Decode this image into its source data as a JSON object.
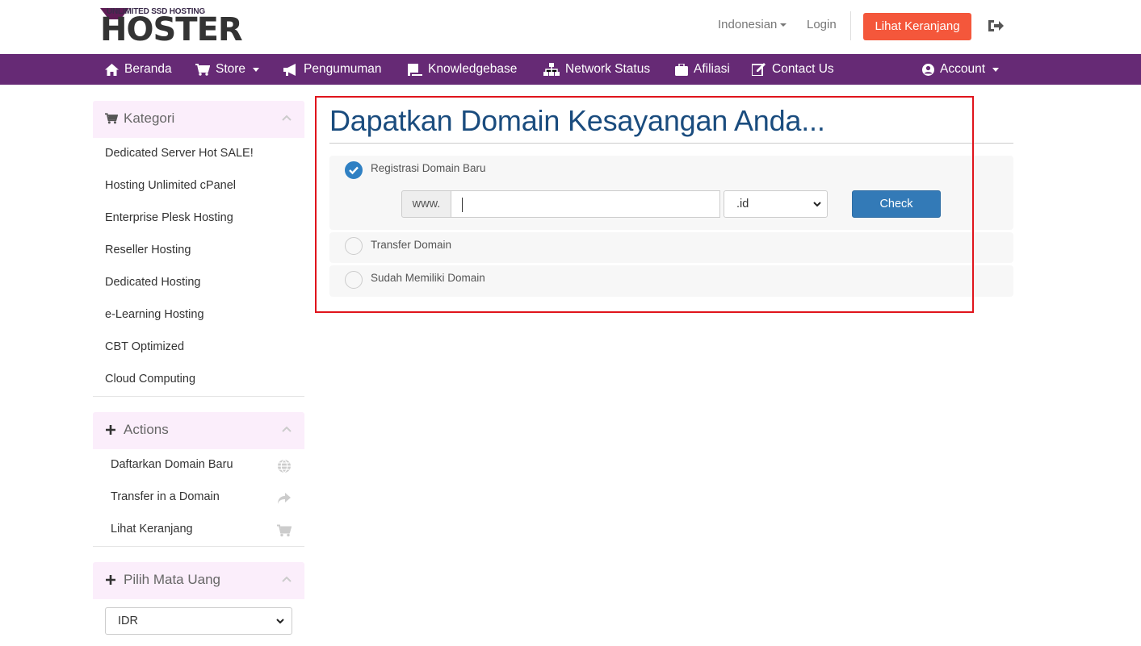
{
  "header": {
    "logo_tagline": "UNLIMITED SSD HOSTING",
    "logo_wordmark": "HOSTER",
    "language": "Indonesian",
    "login": "Login",
    "cart_button": "Lihat Keranjang",
    "logout_icon": "sign-out-icon"
  },
  "nav": {
    "items": [
      {
        "label": "Beranda",
        "icon": "home-icon"
      },
      {
        "label": "Store",
        "icon": "cart-icon",
        "dropdown": true
      },
      {
        "label": "Pengumuman",
        "icon": "bullhorn-icon"
      },
      {
        "label": "Knowledgebase",
        "icon": "book-icon"
      },
      {
        "label": "Network Status",
        "icon": "sitemap-icon"
      },
      {
        "label": "Afiliasi",
        "icon": "briefcase-icon"
      },
      {
        "label": "Contact Us",
        "icon": "edit-icon"
      }
    ],
    "account": {
      "label": "Account",
      "icon": "user-circle-icon",
      "dropdown": true
    },
    "background_color": "#662a75"
  },
  "sidebar": {
    "categories": {
      "title": "Kategori",
      "items": [
        "Dedicated Server Hot SALE!",
        "Hosting Unlimited cPanel",
        "Enterprise Plesk Hosting",
        "Reseller Hosting",
        "Dedicated Hosting",
        "e-Learning Hosting",
        "CBT Optimized",
        "Cloud Computing"
      ]
    },
    "actions": {
      "title": "Actions",
      "items": [
        {
          "label": "Daftarkan Domain Baru",
          "icon": "globe-icon"
        },
        {
          "label": "Transfer in a Domain",
          "icon": "share-icon"
        },
        {
          "label": "Lihat Keranjang",
          "icon": "cart-icon"
        }
      ]
    },
    "currency": {
      "title": "Pilih Mata Uang",
      "selected": "IDR"
    }
  },
  "main": {
    "title": "Dapatkan Domain Kesayangan Anda...",
    "options": [
      {
        "label": "Registrasi Domain Baru",
        "checked": true
      },
      {
        "label": "Transfer Domain",
        "checked": false
      },
      {
        "label": "Sudah Memiliki Domain",
        "checked": false
      }
    ],
    "www_prefix": "www.",
    "domain_input_value": "",
    "tld_selected": ".id",
    "check_button": "Check"
  },
  "colors": {
    "accent_orange": "#f4573b",
    "primary_blue": "#337ab7",
    "title_blue": "#1a4c7e",
    "highlight_red": "#e0141c",
    "panel_pink": "#fbeefb"
  }
}
